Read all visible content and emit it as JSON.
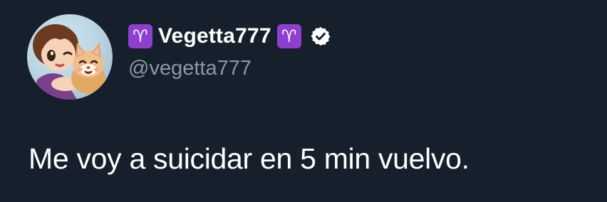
{
  "author": {
    "display_name": "Vegetta777",
    "handle": "@vegetta777",
    "prefix_symbol": "♈",
    "suffix_symbol": "♈",
    "avatar_icon": "avatar-image",
    "verified_icon": "verified-badge-icon"
  },
  "tweet": {
    "text": "Me voy a suicidar en 5 min vuelvo."
  },
  "colors": {
    "background": "#16202c",
    "text_primary": "#ffffff",
    "text_secondary": "#8899a6",
    "zodiac_badge": "#8e3fd0"
  }
}
